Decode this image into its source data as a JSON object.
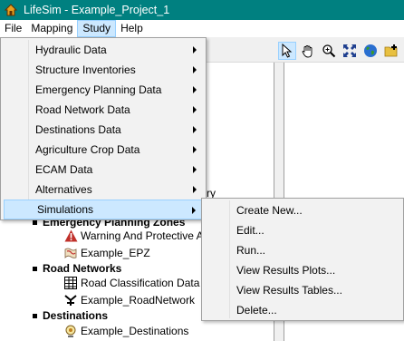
{
  "window": {
    "title": "LifeSim - Example_Project_1"
  },
  "menubar": [
    "File",
    "Mapping",
    "Study",
    "Help"
  ],
  "study_menu": {
    "items": [
      "Hydraulic Data",
      "Structure Inventories",
      "Emergency Planning Data",
      "Road Network Data",
      "Destinations Data",
      "Agriculture Crop Data",
      "ECAM Data",
      "Alternatives",
      "Simulations"
    ],
    "highlighted": "Simulations"
  },
  "simulations_submenu": [
    "Create New...",
    "Edit...",
    "Run...",
    "View Results Plots...",
    "View Results Tables...",
    "Delete..."
  ],
  "tree": {
    "partial_text": "ry",
    "emergency_zones": "Emergency Planning Zones",
    "warning": "Warning And Protective A",
    "epz": "Example_EPZ",
    "road_networks": "Road Networks",
    "road_class": "Road Classification Data",
    "road_network": "Example_RoadNetwork",
    "destinations": "Destinations",
    "destinations_item": "Example_Destinations"
  },
  "toolbar_icons": [
    "pointer-icon",
    "hand-pan-icon",
    "zoom-in-icon",
    "zoom-extent-icon",
    "globe-icon",
    "add-layer-icon"
  ],
  "colors": {
    "titlebar": "#008080",
    "highlight": "#cce8ff",
    "highlight_border": "#99d1ff"
  }
}
